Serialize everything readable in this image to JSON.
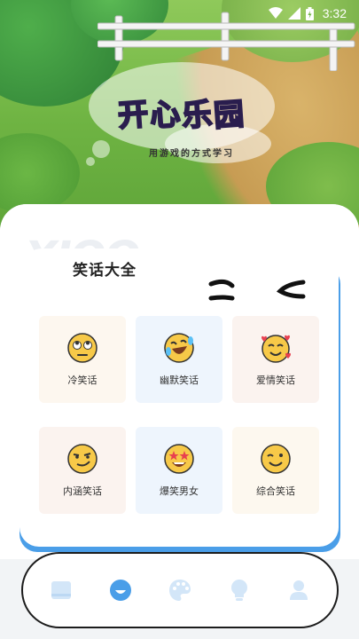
{
  "status_bar": {
    "time": "3:32",
    "icons": [
      "wifi-icon",
      "signal-icon",
      "battery-icon"
    ]
  },
  "logo": {
    "title_chars": [
      "开",
      "心",
      "乐",
      "园"
    ],
    "title_colors": [
      "#e94b6a",
      "#f5a623",
      "#3fb6e8",
      "#f26b8a"
    ],
    "subtitle": "用游戏的方式学习"
  },
  "section": {
    "title": "笑话大全"
  },
  "categories": [
    {
      "label": "冷笑话",
      "icon": "rolling-eyes-emoji-icon",
      "bg": "#fdf7ef"
    },
    {
      "label": "幽默笑话",
      "icon": "laughing-tears-emoji-icon",
      "bg": "#eef5fd"
    },
    {
      "label": "爱情笑话",
      "icon": "smiling-hearts-emoji-icon",
      "bg": "#fbf3ef"
    },
    {
      "label": "内涵笑话",
      "icon": "smirking-emoji-icon",
      "bg": "#fbf3ef"
    },
    {
      "label": "爆笑男女",
      "icon": "star-struck-emoji-icon",
      "bg": "#eef5fd"
    },
    {
      "label": "综合笑话",
      "icon": "winking-emoji-icon",
      "bg": "#fdf8ef"
    }
  ],
  "nav": {
    "items": [
      {
        "icon": "book-icon",
        "active": false
      },
      {
        "icon": "smile-icon",
        "active": true
      },
      {
        "icon": "palette-icon",
        "active": false
      },
      {
        "icon": "lightbulb-icon",
        "active": false
      },
      {
        "icon": "user-icon",
        "active": false
      }
    ],
    "active_color": "#4a9ee8",
    "inactive_color": "#d3e6f8"
  },
  "colors": {
    "accent": "#4a9ee8",
    "emoji_yellow": "#f7c948"
  }
}
